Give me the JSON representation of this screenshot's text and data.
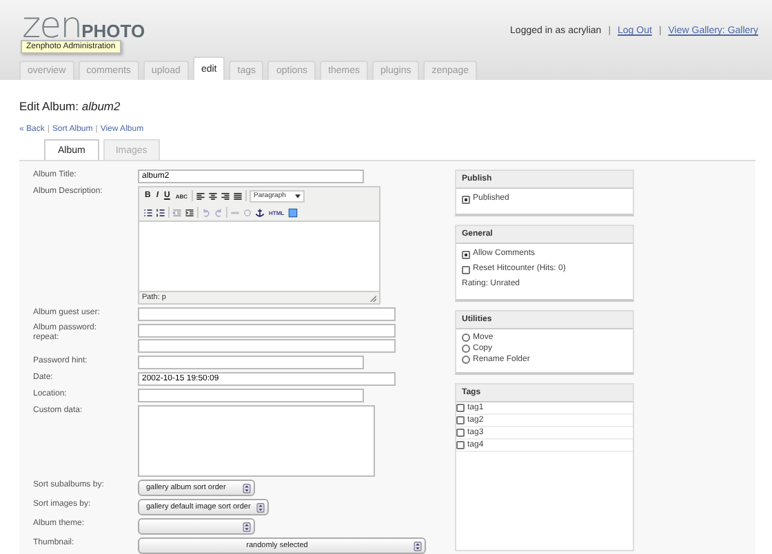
{
  "header": {
    "logo_light": "zen",
    "logo_bold": "PHOTO",
    "logo_tooltip": "Zenphoto Administration",
    "user_text": "Logged in as acrylian",
    "separator": "|",
    "links": [
      "Log Out",
      "View Gallery: Gallery"
    ]
  },
  "nav_tabs": [
    {
      "label": "overview",
      "selected": false
    },
    {
      "label": "comments",
      "selected": false
    },
    {
      "label": "upload",
      "selected": false
    },
    {
      "label": "edit",
      "selected": true
    },
    {
      "label": "tags",
      "selected": false
    },
    {
      "label": "options",
      "selected": false
    },
    {
      "label": "themes",
      "selected": false
    },
    {
      "label": "plugins",
      "selected": false
    },
    {
      "label": "zenpage",
      "selected": false
    }
  ],
  "page_title": "Edit Album:",
  "album_name": "album2",
  "breadcrumbs": [
    "« Back",
    "Sort Album",
    "View Album"
  ],
  "breadcrumb_separator": "|",
  "sub_tabs": [
    {
      "label": "Album",
      "selected": true
    },
    {
      "label": "Images",
      "selected": false
    }
  ],
  "form": [
    {
      "kind": "short",
      "label": "Album Title:",
      "value": "album2"
    },
    {
      "kind": "editor",
      "label": "Album Description:",
      "toolbar": [
        "B",
        "I",
        "U",
        "ABC"
      ],
      "format": "Paragraph",
      "html_button": "HTML",
      "path": "Path: p"
    },
    {
      "kind": "wide",
      "label": "Album guest user:"
    },
    {
      "kind": "password",
      "label": "Album password:",
      "label2": "repeat:"
    },
    {
      "kind": "short",
      "label": "Password hint:"
    },
    {
      "kind": "wide",
      "label": "Date:",
      "value": "2002-10-15 19:50:09"
    },
    {
      "kind": "short",
      "label": "Location:"
    },
    {
      "kind": "textarea",
      "label": "Custom data:"
    },
    {
      "kind": "select",
      "label": "Sort subalbums by:",
      "value": "gallery album sort order"
    },
    {
      "kind": "select",
      "label": "Sort images by:",
      "value": "gallery default image sort order"
    },
    {
      "kind": "select",
      "label": "Album theme:"
    },
    {
      "kind": "wideselect",
      "label": "Thumbnail:",
      "value": "randomly selected"
    }
  ],
  "panels": [
    {
      "title": "Publish",
      "items": [
        {
          "kind": "checkbox",
          "label": "Published",
          "checked": true
        }
      ]
    },
    {
      "title": "General",
      "items": [
        {
          "kind": "checkbox",
          "label": "Allow Comments",
          "checked": true
        },
        {
          "kind": "checkbox",
          "label": "Reset Hitcounter (Hits: 0)",
          "checked": false
        },
        {
          "kind": "text",
          "label": "Rating: Unrated"
        }
      ]
    },
    {
      "title": "Utilities",
      "items": [
        {
          "kind": "radio",
          "label": "Move",
          "checked": false
        },
        {
          "kind": "radio",
          "label": "Copy",
          "checked": false
        },
        {
          "kind": "radio",
          "label": "Rename Folder",
          "checked": false
        }
      ]
    }
  ],
  "tags": {
    "title": "Tags",
    "items": [
      {
        "label": "tag1",
        "checked": false
      },
      {
        "label": "tag2",
        "checked": false
      },
      {
        "label": "tag3",
        "checked": false
      },
      {
        "label": "tag4",
        "checked": false
      }
    ]
  }
}
